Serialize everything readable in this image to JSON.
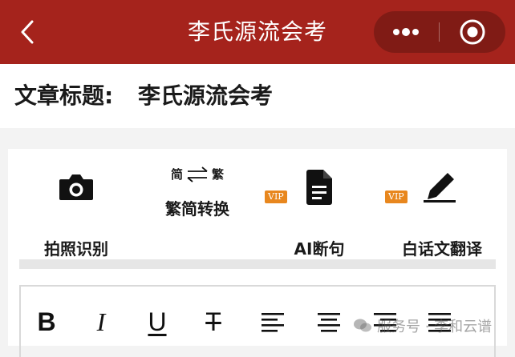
{
  "header": {
    "title": "李氏源流会考",
    "back_icon": "chevron-left-icon",
    "more_icon": "more-dots-icon",
    "close_icon": "target-circle-icon",
    "bg_color": "#a5231c"
  },
  "article": {
    "label": "文章标题:",
    "value": "李氏源流会考"
  },
  "tools": [
    {
      "label": "拍照识别",
      "icon": "camera-icon"
    },
    {
      "label": "繁简转换",
      "top_left": "简",
      "top_right": "繁",
      "icon": "swap-arrows-icon"
    },
    {
      "label": "AI断句",
      "badge": "VIP",
      "icon": "document-icon"
    },
    {
      "label": "白话文翻译",
      "badge": "VIP",
      "icon": "pen-icon"
    }
  ],
  "vip_color": "#e8871e",
  "format_toolbar": {
    "bold": "B",
    "italic": "I",
    "underline": "U",
    "strike": "T"
  },
  "watermark": "服务号 · 李和云谱"
}
